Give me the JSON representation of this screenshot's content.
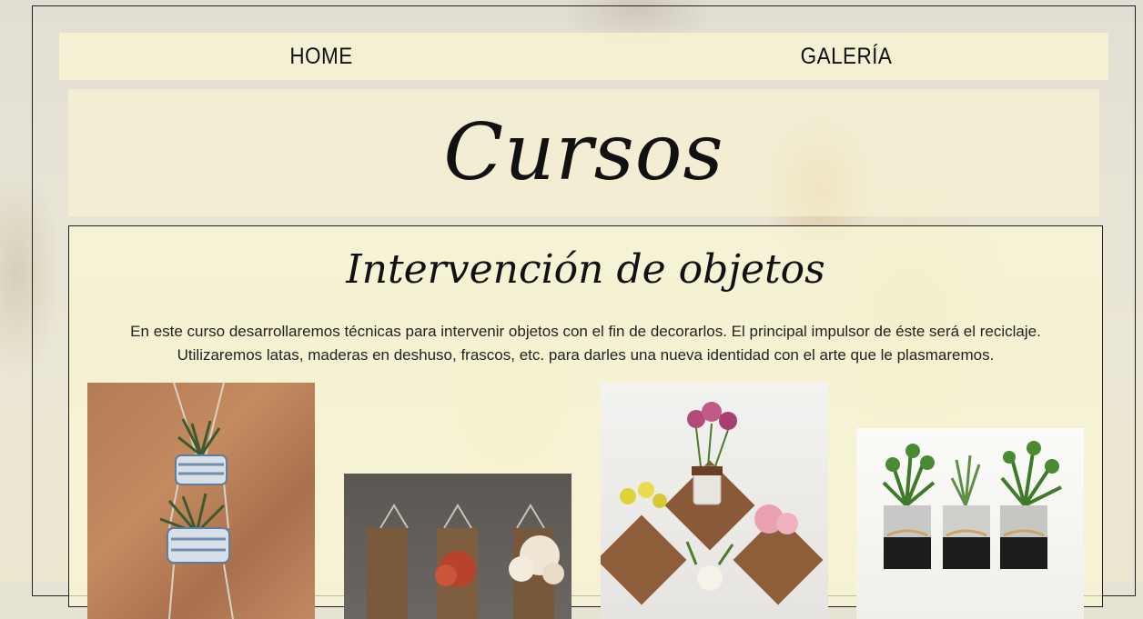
{
  "nav": {
    "home_label": "HOME",
    "gallery_label": "GALERÍA"
  },
  "hero": {
    "title": "Cursos"
  },
  "course": {
    "title": "Intervención de objetos",
    "description": "En este curso desarrollaremos técnicas para intervenir objetos con el fin de decorarlos. El principal impulsor de éste será el reciclaje. Utilizaremos latas, maderas en deshuso, frascos, etc. para darles una nueva identidad con el arte que le plasmaremos.",
    "photos": [
      {
        "subject": "hanging-tin-planters"
      },
      {
        "subject": "wooden-board-flower-vases"
      },
      {
        "subject": "mason-jar-wall-vases"
      },
      {
        "subject": "painted-can-herb-pots"
      }
    ]
  },
  "colors": {
    "panel": "#faf6d2",
    "text": "#111111",
    "border": "#222222"
  }
}
